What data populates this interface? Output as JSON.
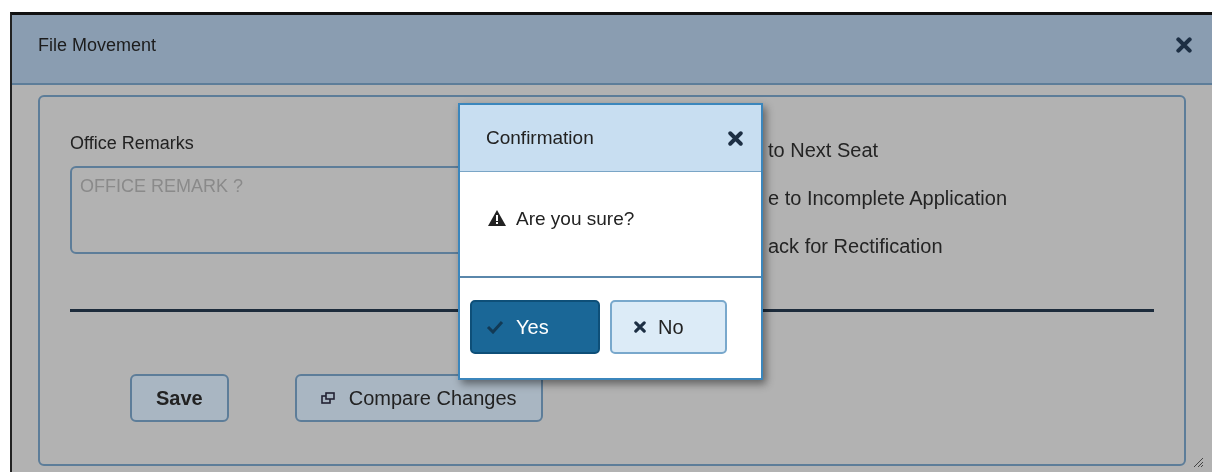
{
  "window": {
    "title": "File Movement"
  },
  "form": {
    "remarks_label": "Office Remarks",
    "remarks_placeholder": "OFFICE REMARK ?",
    "options": [
      "to Next Seat",
      "e to Incomplete Application",
      "ack for Rectification"
    ],
    "buttons": [
      {
        "kind": "plain",
        "label": "Save"
      },
      {
        "kind": "icon",
        "label": "Compare Changes"
      }
    ]
  },
  "dialog": {
    "title": "Confirmation",
    "message": "Are you sure?",
    "buttons": [
      {
        "kind": "yes",
        "label": "Yes",
        "selected": true
      },
      {
        "kind": "no",
        "label": "No",
        "selected": false
      }
    ]
  }
}
